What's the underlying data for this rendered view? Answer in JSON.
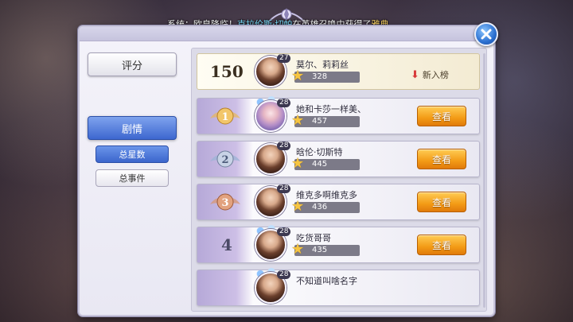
{
  "announcement": {
    "prefix": "系统：",
    "text1": "欧皇降临！",
    "player": "克拉伦斯·切帕",
    "text2": "在英雄召唤中获得了",
    "item": "雅典"
  },
  "sidebar": {
    "score_label": "评分",
    "story_label": "剧情",
    "sub_total_stars": "总星数",
    "sub_total_events": "总事件"
  },
  "self_entry": {
    "rank": "150",
    "level": "27",
    "name": "莫尔、莉莉丝",
    "stars": "328",
    "status": "新入榜"
  },
  "entries": [
    {
      "rank": "1",
      "level": "28",
      "name": "她和卡莎一样美、",
      "stars": "457",
      "button": "查看",
      "medal": "gold"
    },
    {
      "rank": "2",
      "level": "28",
      "name": "晗伦·切斯特",
      "stars": "445",
      "button": "查看",
      "medal": "silver"
    },
    {
      "rank": "3",
      "level": "28",
      "name": "维克多啊维克多",
      "stars": "436",
      "button": "查看",
      "medal": "bronze"
    },
    {
      "rank": "4",
      "level": "28",
      "name": "吃货哥哥",
      "stars": "435",
      "button": "查看",
      "medal": "none"
    },
    {
      "rank": "",
      "level": "28",
      "name": "不知道叫啥名字",
      "stars": "",
      "button": "",
      "medal": "none"
    }
  ],
  "colors": {
    "accent_blue": "#3d67cf",
    "view_orange": "#f39b16",
    "star_gold": "#f6c542"
  }
}
